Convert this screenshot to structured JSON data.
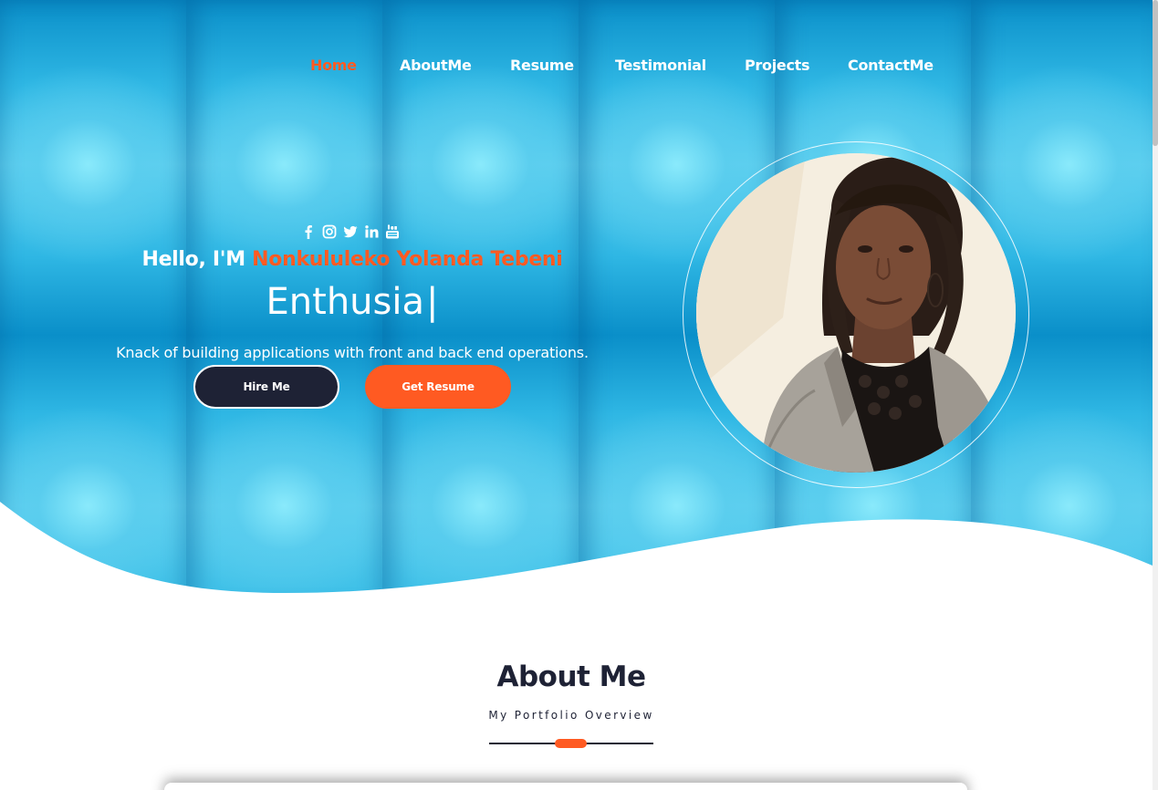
{
  "nav": {
    "items": [
      {
        "label": "Home",
        "active": true
      },
      {
        "label": "AboutMe",
        "active": false
      },
      {
        "label": "Resume",
        "active": false
      },
      {
        "label": "Testimonial",
        "active": false
      },
      {
        "label": "Projects",
        "active": false
      },
      {
        "label": "ContactMe",
        "active": false
      }
    ]
  },
  "social": {
    "icons": [
      "facebook-icon",
      "instagram-icon",
      "twitter-icon",
      "linkedin-icon",
      "youtube-icon"
    ]
  },
  "hero": {
    "greeting_prefix": "Hello, I'M ",
    "name": "Nonkululeko Yolanda Tebeni",
    "typed_text": "Enthusia",
    "cursor": "|",
    "tagline": "Knack of building applications with front and back end operations.",
    "hire_label": "Hire Me",
    "resume_label": "Get Resume"
  },
  "about": {
    "title": "About Me",
    "subtitle": "My Portfolio Overview"
  },
  "colors": {
    "accent": "#ff5a22",
    "dark": "#1e2235",
    "hero_blue": "#24b4e2"
  }
}
